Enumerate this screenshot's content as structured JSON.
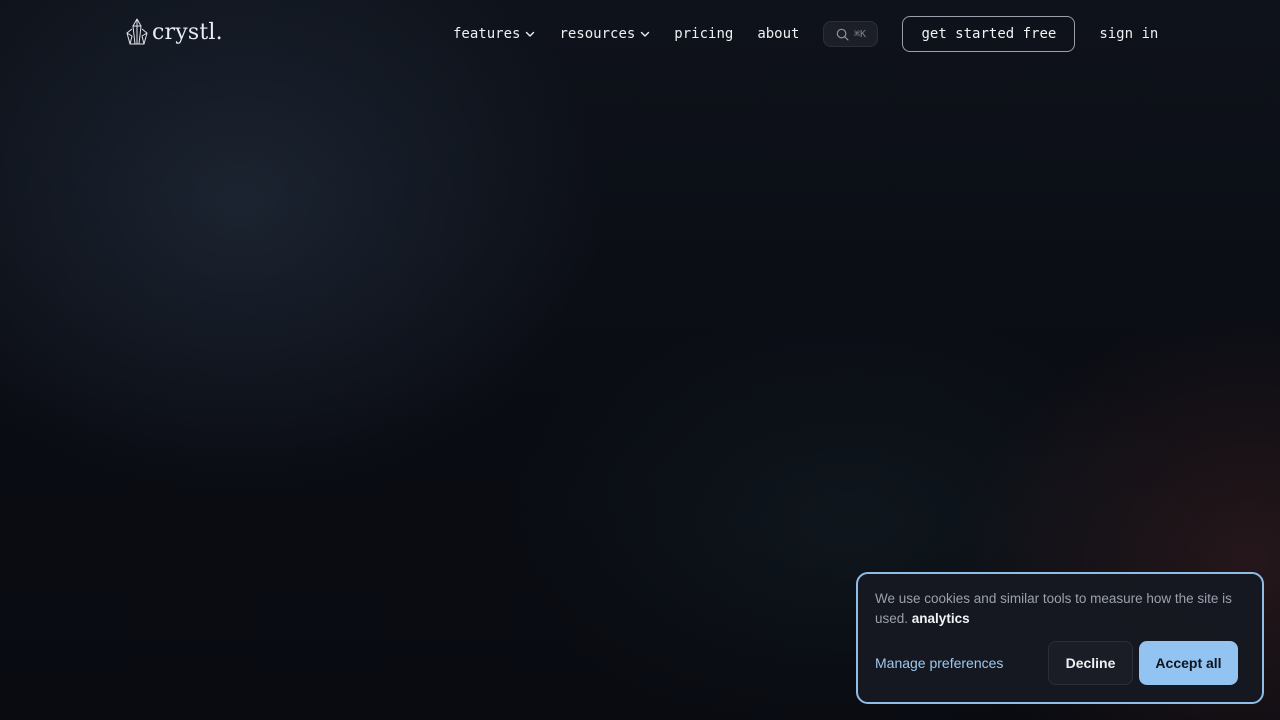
{
  "brand": {
    "name": "crystl.",
    "logo_icon": "crystal-icon"
  },
  "nav": {
    "items": [
      {
        "label": "features",
        "has_dropdown": true
      },
      {
        "label": "resources",
        "has_dropdown": true
      },
      {
        "label": "pricing",
        "has_dropdown": false
      },
      {
        "label": "about",
        "has_dropdown": false
      }
    ],
    "search": {
      "icon": "search-icon",
      "shortcut": "⌘K"
    },
    "cta_label": "get started free",
    "signin_label": "sign in"
  },
  "cookie_banner": {
    "message": "We use cookies and similar tools to measure how the site is used.",
    "highlight": "analytics",
    "manage_label": "Manage preferences",
    "decline_label": "Decline",
    "accept_label": "Accept all"
  },
  "colors": {
    "background": "#0a0c13",
    "banner_border": "#8fbde6",
    "accept_button": "#93c3f0",
    "link": "#9cc8ef"
  }
}
